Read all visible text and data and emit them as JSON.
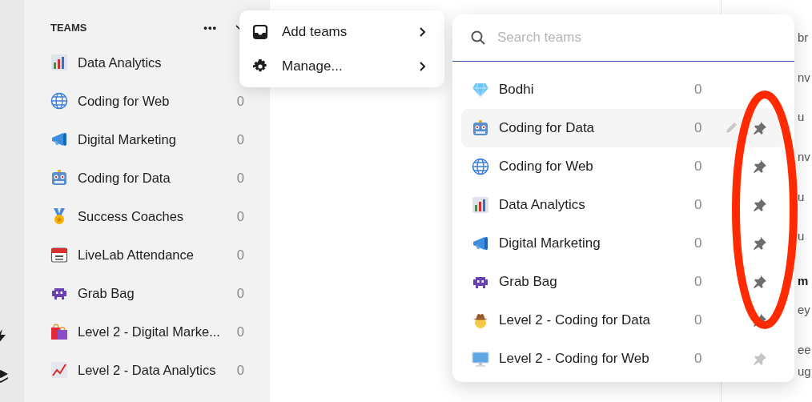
{
  "sidebar": {
    "header": "TEAMS",
    "more": "•••",
    "items": [
      {
        "kind": "bar-chart",
        "name": "Data Analytics"
      },
      {
        "kind": "globe",
        "name": "Coding for Web",
        "count": "0"
      },
      {
        "kind": "megaphone",
        "name": "Digital Marketing",
        "count": "0"
      },
      {
        "kind": "robot",
        "name": "Coding for Data",
        "count": "0"
      },
      {
        "kind": "medal",
        "name": "Success Coaches",
        "count": "0"
      },
      {
        "kind": "calendar",
        "name": "LiveLab Attendance",
        "count": "0"
      },
      {
        "kind": "invader",
        "name": "Grab Bag",
        "count": "0"
      },
      {
        "kind": "bags",
        "name": "Level 2 - Digital Marke...",
        "count": "0"
      },
      {
        "kind": "line-chart",
        "name": "Level 2 - Data Analytics",
        "count": "0"
      }
    ]
  },
  "menu": {
    "items": [
      {
        "kind": "tray",
        "label": "Add teams"
      },
      {
        "kind": "gear",
        "label": "Manage..."
      }
    ]
  },
  "team_picker": {
    "search": {
      "placeholder": "Search teams"
    },
    "items": [
      {
        "kind": "diamond",
        "name": "Bodhi",
        "count": "0",
        "highlighted": false,
        "pinnable": false
      },
      {
        "kind": "robot",
        "name": "Coding for Data",
        "count": "0",
        "highlighted": true,
        "pinnable": true,
        "pinned": true
      },
      {
        "kind": "globe",
        "name": "Coding for Web",
        "count": "0",
        "highlighted": false,
        "pinnable": true,
        "pinned": true
      },
      {
        "kind": "bar-chart",
        "name": "Data Analytics",
        "count": "0",
        "highlighted": false,
        "pinnable": true,
        "pinned": true
      },
      {
        "kind": "megaphone",
        "name": "Digital Marketing",
        "count": "0",
        "highlighted": false,
        "pinnable": true,
        "pinned": true
      },
      {
        "kind": "invader",
        "name": "Grab Bag",
        "count": "0",
        "highlighted": false,
        "pinnable": true,
        "pinned": true
      },
      {
        "kind": "hat-figure",
        "name": "Level 2 - Coding for Data",
        "count": "0",
        "highlighted": false,
        "pinnable": true,
        "pinned": true
      },
      {
        "kind": "monitor",
        "name": "Level 2 - Coding for Web",
        "count": "0",
        "highlighted": false,
        "pinnable": true,
        "pinned": false
      }
    ]
  },
  "right_panel": {
    "fragments": [
      {
        "text": "br",
        "bold": false
      },
      {
        "text": "nv",
        "bold": false
      },
      {
        "text": "u",
        "bold": false
      },
      {
        "text": "nv",
        "bold": false
      },
      {
        "text": "u",
        "bold": false
      },
      {
        "text": "u",
        "bold": false
      },
      {
        "text": "m",
        "bold": true
      },
      {
        "text": "ey",
        "bold": false
      },
      {
        "text": "ee",
        "bold": false
      },
      {
        "text": "ug",
        "bold": false
      }
    ]
  },
  "annotation": {
    "kind": "ellipse",
    "color": "#ff2a00"
  }
}
